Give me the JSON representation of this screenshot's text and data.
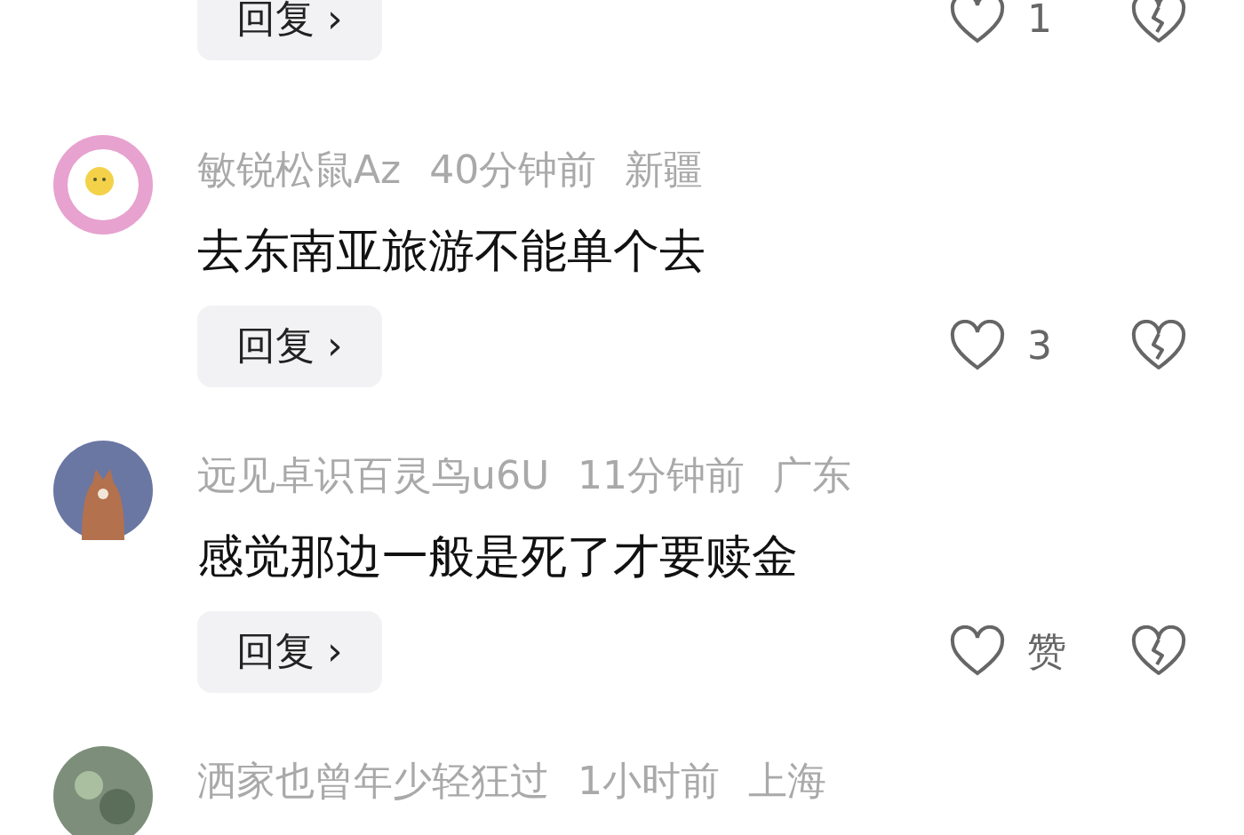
{
  "comments": [
    {
      "reply_button": "回复 ›",
      "likes": "1"
    },
    {
      "author": "敏锐松鼠Az",
      "time": "40分钟前",
      "location": "新疆",
      "avatar": {
        "kind": "egg"
      },
      "text": "去东南亚旅游不能单个去",
      "reply_button": "回复 ›",
      "likes": "3"
    },
    {
      "author": "远见卓识百灵鸟u6U",
      "time": "11分钟前",
      "location": "广东",
      "avatar": {
        "kind": "bird"
      },
      "text": "感觉那边一般是死了才要赎金",
      "reply_button": "回复 ›",
      "likes": "赞"
    },
    {
      "author": "洒家也曾年少轻狂过",
      "time": "1小时前",
      "location": "上海",
      "avatar": {
        "kind": "photo"
      }
    }
  ]
}
